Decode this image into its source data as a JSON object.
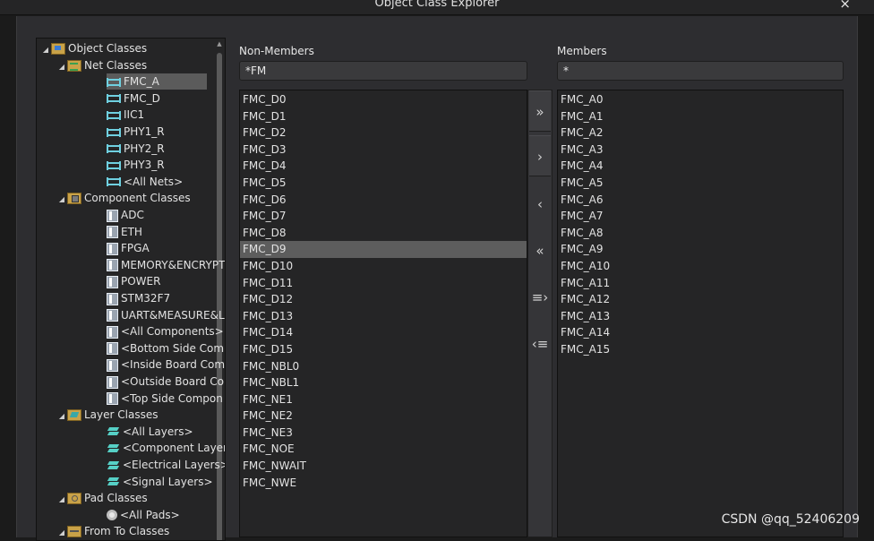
{
  "window": {
    "title": "Object Class Explorer",
    "close_glyph": "×"
  },
  "tree": {
    "nodes": [
      {
        "label": "Object Classes",
        "icon": "object-classes-folder-icon",
        "level": 0,
        "expanded": true
      },
      {
        "label": "Net Classes",
        "icon": "net-classes-folder-icon",
        "level": 1,
        "expanded": true
      },
      {
        "label": "FMC_A",
        "icon": "net-class-icon",
        "level": 2,
        "selected": true
      },
      {
        "label": "FMC_D",
        "icon": "net-class-icon",
        "level": 2
      },
      {
        "label": "IIC1",
        "icon": "net-class-icon",
        "level": 2
      },
      {
        "label": "PHY1_R",
        "icon": "net-class-icon",
        "level": 2
      },
      {
        "label": "PHY2_R",
        "icon": "net-class-icon",
        "level": 2
      },
      {
        "label": "PHY3_R",
        "icon": "net-class-icon",
        "level": 2
      },
      {
        "label": "<All Nets>",
        "icon": "net-class-icon",
        "level": 2
      },
      {
        "label": "Component Classes",
        "icon": "component-classes-folder-icon",
        "level": 1,
        "expanded": true
      },
      {
        "label": "ADC",
        "icon": "component-class-icon",
        "level": 2
      },
      {
        "label": "ETH",
        "icon": "component-class-icon",
        "level": 2
      },
      {
        "label": "FPGA",
        "icon": "component-class-icon",
        "level": 2
      },
      {
        "label": "MEMORY&ENCRYPT",
        "icon": "component-class-icon",
        "level": 2
      },
      {
        "label": "POWER",
        "icon": "component-class-icon",
        "level": 2
      },
      {
        "label": "STM32F7",
        "icon": "component-class-icon",
        "level": 2
      },
      {
        "label": "UART&MEASURE&L",
        "icon": "component-class-icon",
        "level": 2
      },
      {
        "label": "<All Components>",
        "icon": "component-class-icon",
        "level": 2
      },
      {
        "label": "<Bottom Side Comp",
        "icon": "component-class-icon",
        "level": 2
      },
      {
        "label": "<Inside Board Com",
        "icon": "component-class-icon",
        "level": 2
      },
      {
        "label": "<Outside Board Co",
        "icon": "component-class-icon",
        "level": 2
      },
      {
        "label": "<Top Side Compon",
        "icon": "component-class-icon",
        "level": 2
      },
      {
        "label": "Layer Classes",
        "icon": "layer-classes-folder-icon",
        "level": 1,
        "expanded": true
      },
      {
        "label": "<All Layers>",
        "icon": "layer-class-icon",
        "level": 2
      },
      {
        "label": "<Component Layer",
        "icon": "layer-class-icon",
        "level": 2
      },
      {
        "label": "<Electrical Layers>",
        "icon": "layer-class-icon",
        "level": 2
      },
      {
        "label": "<Signal Layers>",
        "icon": "layer-class-icon",
        "level": 2
      },
      {
        "label": "Pad Classes",
        "icon": "pad-classes-folder-icon",
        "level": 1,
        "expanded": true
      },
      {
        "label": "<All Pads>",
        "icon": "pad-class-icon",
        "level": 2
      },
      {
        "label": "From To Classes",
        "icon": "from-to-classes-folder-icon",
        "level": 1,
        "expanded": true
      }
    ]
  },
  "non_members": {
    "label": "Non-Members",
    "filter": "*FM",
    "items": [
      "FMC_D0",
      "FMC_D1",
      "FMC_D2",
      "FMC_D3",
      "FMC_D4",
      "FMC_D5",
      "FMC_D6",
      "FMC_D7",
      "FMC_D8",
      "FMC_D9",
      "FMC_D10",
      "FMC_D11",
      "FMC_D12",
      "FMC_D13",
      "FMC_D14",
      "FMC_D15",
      "FMC_NBL0",
      "FMC_NBL1",
      "FMC_NE1",
      "FMC_NE2",
      "FMC_NE3",
      "FMC_NOE",
      "FMC_NWAIT",
      "FMC_NWE"
    ],
    "selected_index": 9
  },
  "members": {
    "label": "Members",
    "filter": "*",
    "items": [
      "FMC_A0",
      "FMC_A1",
      "FMC_A2",
      "FMC_A3",
      "FMC_A4",
      "FMC_A5",
      "FMC_A6",
      "FMC_A7",
      "FMC_A8",
      "FMC_A9",
      "FMC_A10",
      "FMC_A11",
      "FMC_A12",
      "FMC_A13",
      "FMC_A14",
      "FMC_A15"
    ]
  },
  "move_buttons": [
    {
      "name": "add-all-button",
      "glyph": "»"
    },
    {
      "name": "add-selected-button",
      "glyph": "›"
    },
    {
      "name": "remove-selected-button",
      "glyph": "‹"
    },
    {
      "name": "remove-all-button",
      "glyph": "«"
    },
    {
      "name": "add-filtered-button",
      "glyph": "≡›"
    },
    {
      "name": "remove-filtered-button",
      "glyph": "‹≡"
    }
  ],
  "watermark": "CSDN @qq_52406209",
  "colors": {
    "background": "#2d2d30",
    "selection": "#5d5d5d",
    "net_icon": "#6fd0e0",
    "layer_icon": "#56d0c6"
  }
}
